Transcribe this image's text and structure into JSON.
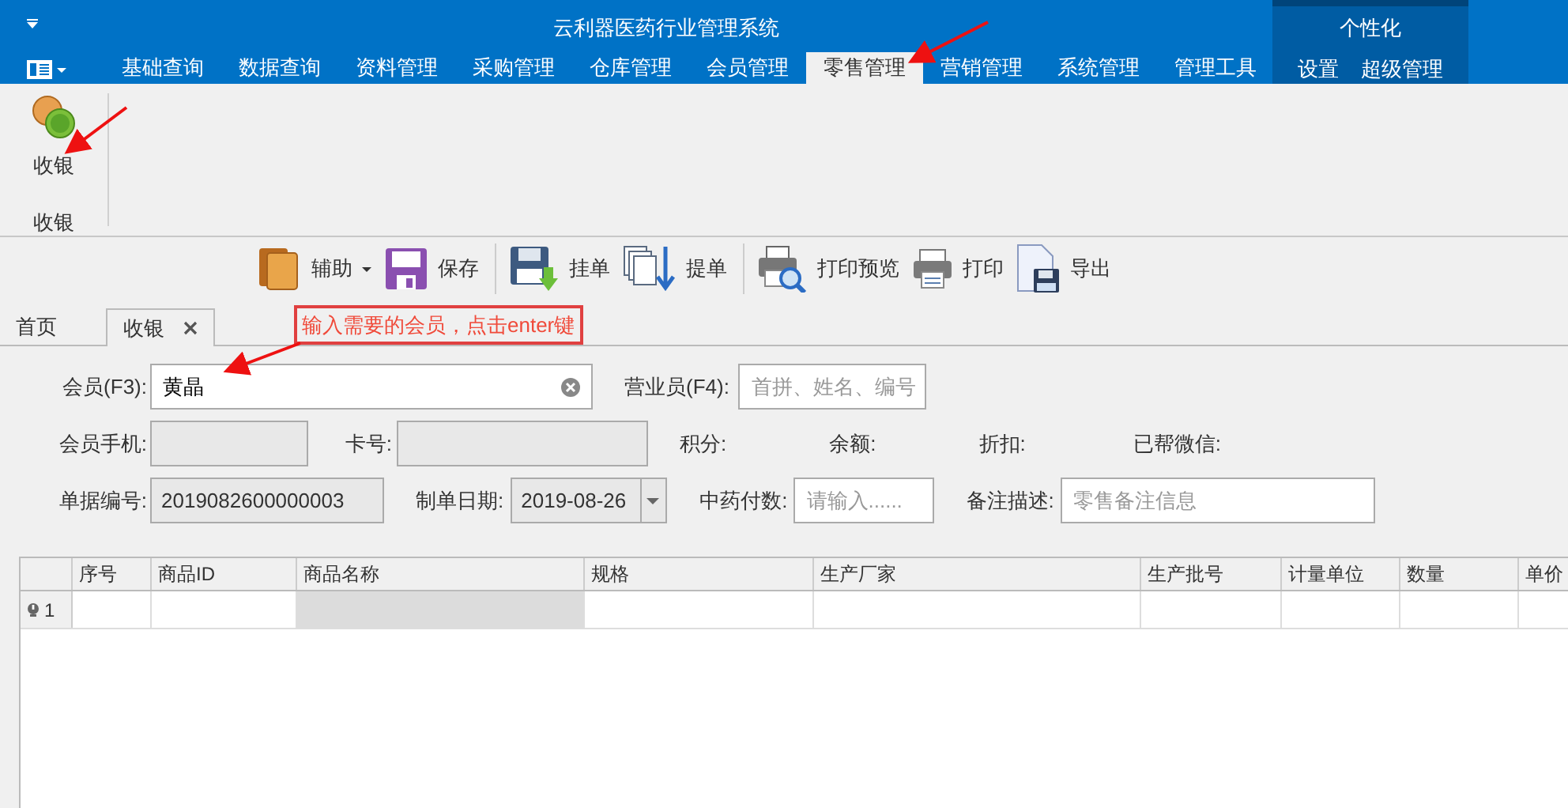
{
  "window": {
    "title": "云利器医药行业管理系统"
  },
  "ribbon_tabs": [
    {
      "label": "基础查询",
      "selected": false
    },
    {
      "label": "数据查询",
      "selected": false
    },
    {
      "label": "资料管理",
      "selected": false
    },
    {
      "label": "采购管理",
      "selected": false
    },
    {
      "label": "仓库管理",
      "selected": false
    },
    {
      "label": "会员管理",
      "selected": false
    },
    {
      "label": "零售管理",
      "selected": true
    },
    {
      "label": "营销管理",
      "selected": false
    },
    {
      "label": "系统管理",
      "selected": false
    },
    {
      "label": "管理工具",
      "selected": false
    }
  ],
  "personalize": {
    "title": "个性化",
    "tabs": [
      {
        "label": "设置",
        "selected": false
      },
      {
        "label": "超级管理",
        "selected": false
      }
    ]
  },
  "ribbon_group": {
    "button": "收银",
    "label": "收银"
  },
  "toolbar": [
    {
      "kind": "books",
      "label": "辅助",
      "dropdown": true
    },
    {
      "kind": "save",
      "label": "保存",
      "dropdown": false
    },
    {
      "kind": "hold",
      "label": "挂单",
      "dropdown": false
    },
    {
      "kind": "fetch",
      "label": "提单",
      "dropdown": false
    },
    {
      "kind": "preview",
      "label": "打印预览",
      "dropdown": false
    },
    {
      "kind": "print",
      "label": "打印",
      "dropdown": false
    },
    {
      "kind": "export",
      "label": "导出",
      "dropdown": false
    }
  ],
  "doc_tabs": [
    {
      "label": "首页",
      "selected": false,
      "closable": false
    },
    {
      "label": "收银",
      "selected": true,
      "closable": true
    }
  ],
  "callout": "输入需要的会员，点击enter键",
  "form": [
    [
      {
        "kind": "label",
        "text": "会员(F3):"
      },
      {
        "kind": "input",
        "value": "黄晶",
        "clearable": true
      },
      {
        "kind": "label",
        "text": "营业员(F4):"
      },
      {
        "kind": "input",
        "placeholder": "首拼、姓名、编号"
      }
    ],
    [
      {
        "kind": "label",
        "text": "会员手机:"
      },
      {
        "kind": "readonly"
      },
      {
        "kind": "label",
        "text": "卡号:"
      },
      {
        "kind": "readonly"
      },
      {
        "kind": "label",
        "text": "积分:"
      },
      {
        "kind": "label",
        "text": "余额:"
      },
      {
        "kind": "label",
        "text": "折扣:"
      },
      {
        "kind": "label",
        "text": "已帮微信:"
      }
    ],
    [
      {
        "kind": "label",
        "text": "单据编号:"
      },
      {
        "kind": "readonly",
        "value": "2019082600000003"
      },
      {
        "kind": "label",
        "text": "制单日期:"
      },
      {
        "kind": "date",
        "value": "2019-08-26"
      },
      {
        "kind": "label",
        "text": "中药付数:"
      },
      {
        "kind": "input",
        "placeholder": "请输入......"
      },
      {
        "kind": "label",
        "text": "备注描述:"
      },
      {
        "kind": "input",
        "placeholder": "零售备注信息"
      }
    ]
  ],
  "grid": {
    "columns": [
      "序号",
      "商品ID",
      "商品名称",
      "规格",
      "生产厂家",
      "生产批号",
      "计量单位",
      "数量",
      "单价"
    ],
    "rows": [
      {
        "header": "1"
      }
    ]
  }
}
